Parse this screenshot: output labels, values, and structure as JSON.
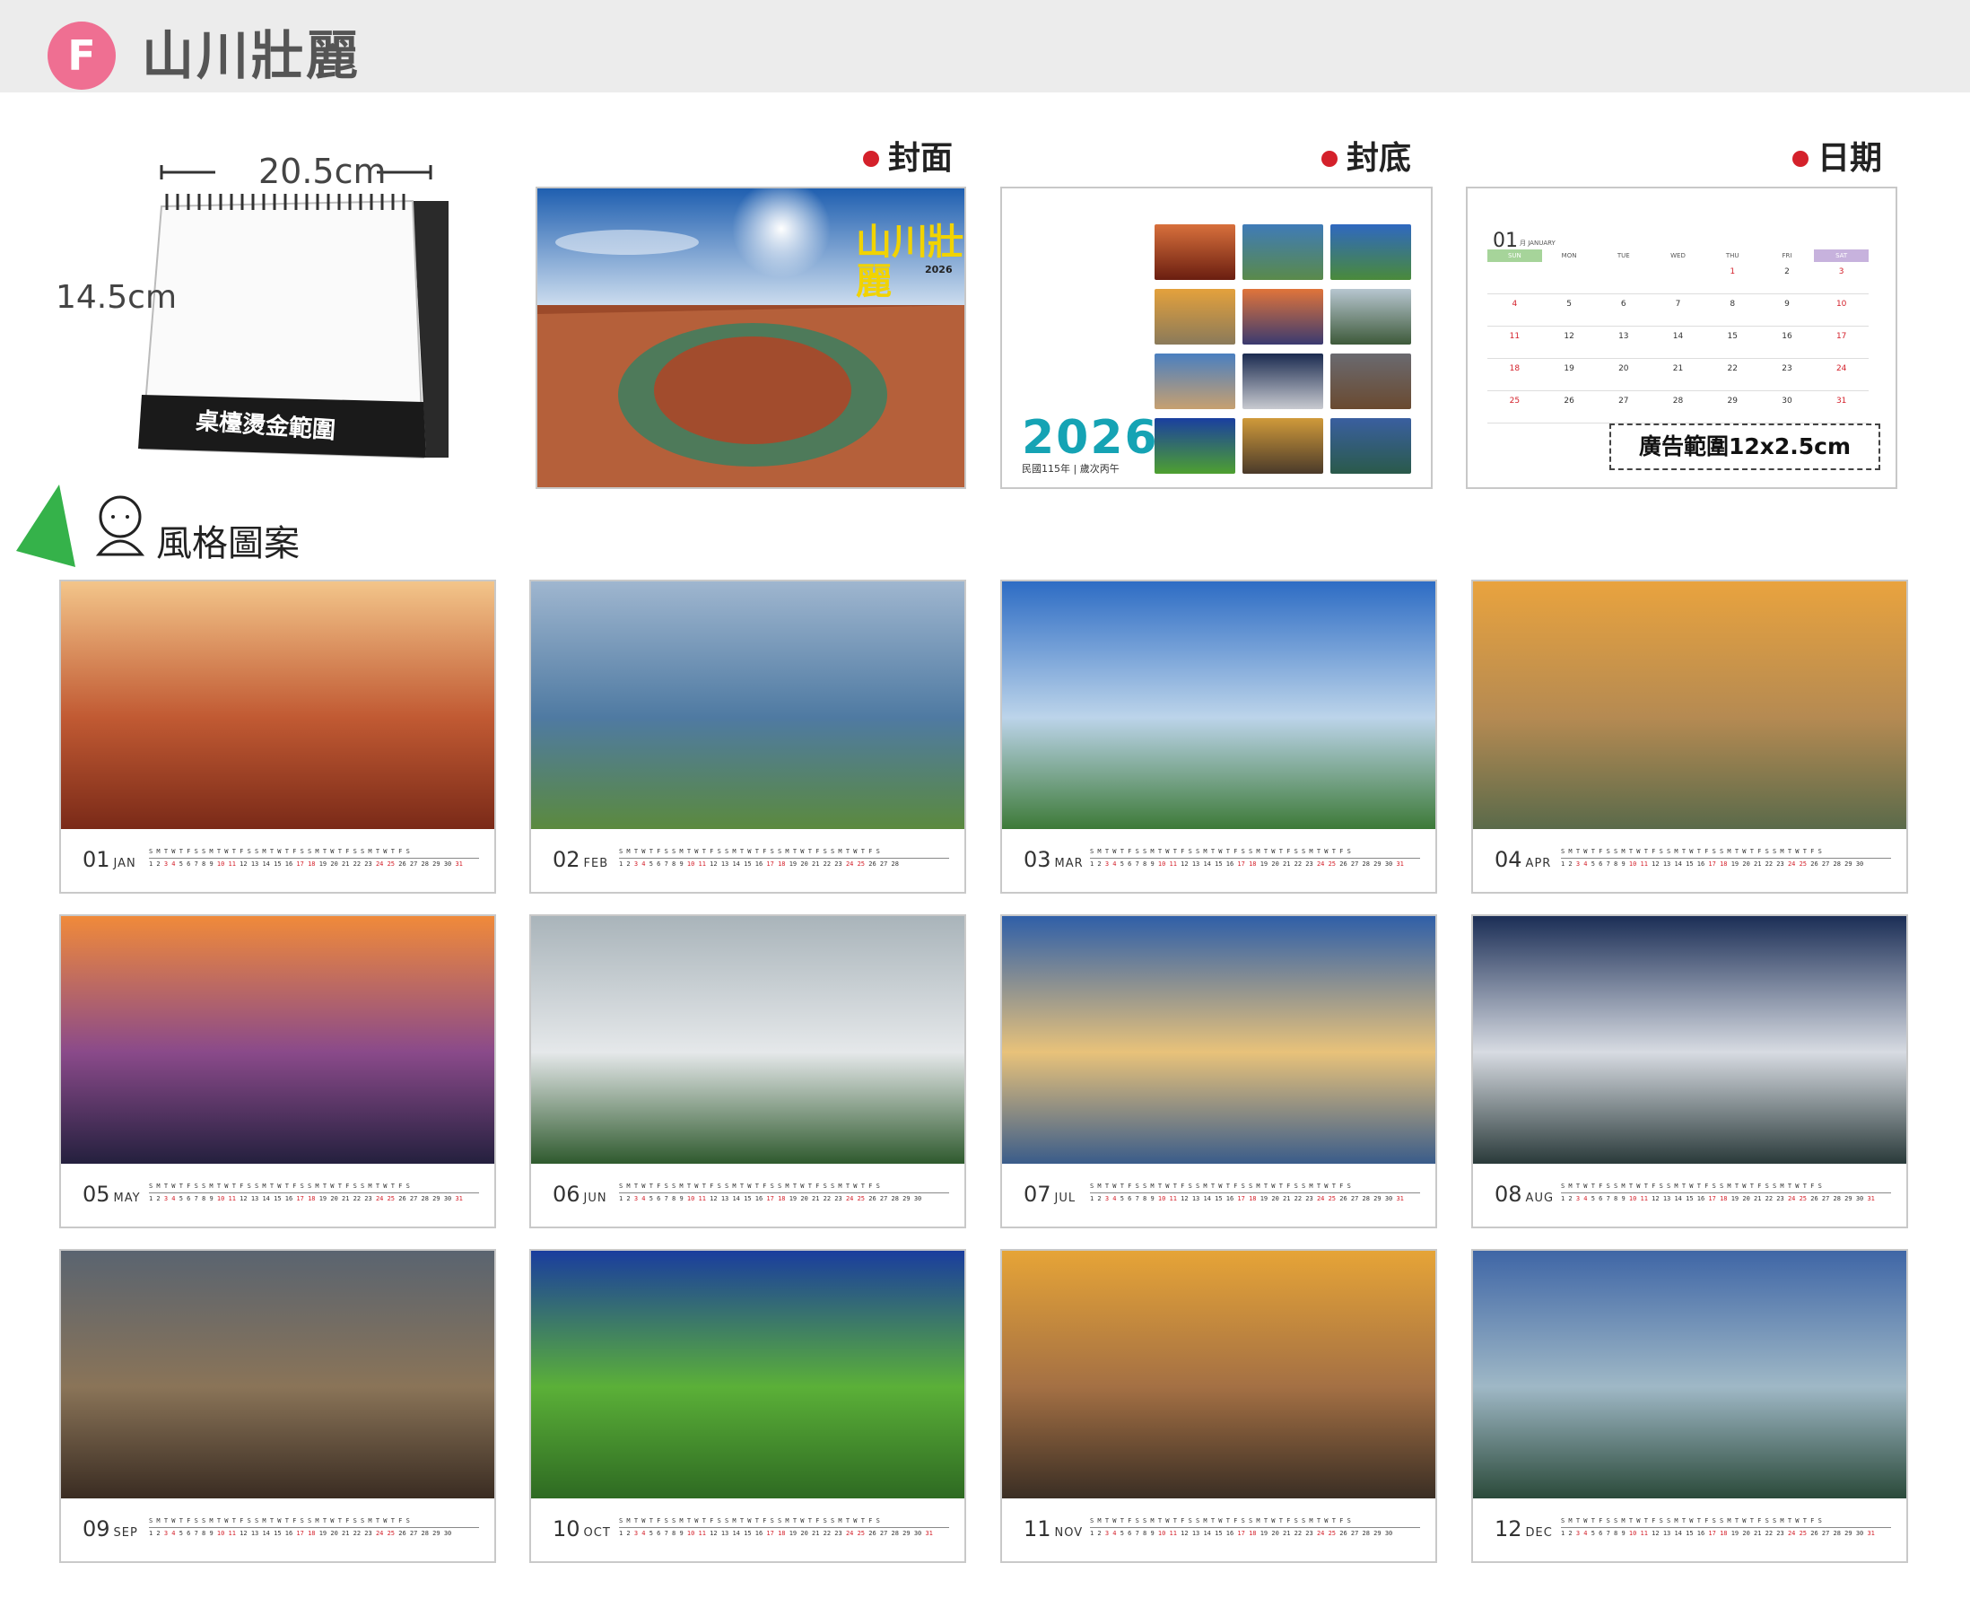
{
  "header": {
    "badge": "F",
    "title": "山川壯麗"
  },
  "desk_calendar": {
    "width_label": "20.5cm",
    "height_label": "14.5cm",
    "foil_area": "桌檯燙金範圍"
  },
  "previews": {
    "cover_label": "封面",
    "cover_title": "山川壯麗",
    "cover_year": "2026",
    "back_label": "封底",
    "back_year": "2026",
    "back_sub": "民國115年 | 歲次丙午",
    "date_label": "日期",
    "date_month_num": "01",
    "date_month_text": "月 JANUARY",
    "weekdays": [
      "SUN",
      "MON",
      "TUE",
      "WED",
      "THU",
      "FRI",
      "SAT"
    ],
    "ad_area": "廣告範圍12x2.5cm"
  },
  "style_label": "風格圖案",
  "months": [
    {
      "num": "01",
      "name": "JAN",
      "theme": "canyon"
    },
    {
      "num": "02",
      "name": "FEB",
      "theme": "mountain-road"
    },
    {
      "num": "03",
      "name": "MAR",
      "theme": "lake-sky"
    },
    {
      "num": "04",
      "name": "APR",
      "theme": "badlands"
    },
    {
      "num": "05",
      "name": "MAY",
      "theme": "sunset-coast"
    },
    {
      "num": "06",
      "name": "JUN",
      "theme": "cloud-forest"
    },
    {
      "num": "07",
      "name": "JUL",
      "theme": "reflection"
    },
    {
      "num": "08",
      "name": "AUG",
      "theme": "sea-of-clouds"
    },
    {
      "num": "09",
      "name": "SEP",
      "theme": "rock-valley"
    },
    {
      "num": "10",
      "name": "OCT",
      "theme": "grassland"
    },
    {
      "num": "11",
      "name": "NOV",
      "theme": "rock-pool"
    },
    {
      "num": "12",
      "name": "DEC",
      "theme": "misty-hills"
    }
  ],
  "colors": {
    "accent": "#ef6f92",
    "red": "#d4212b",
    "teal": "#15a3b4"
  }
}
